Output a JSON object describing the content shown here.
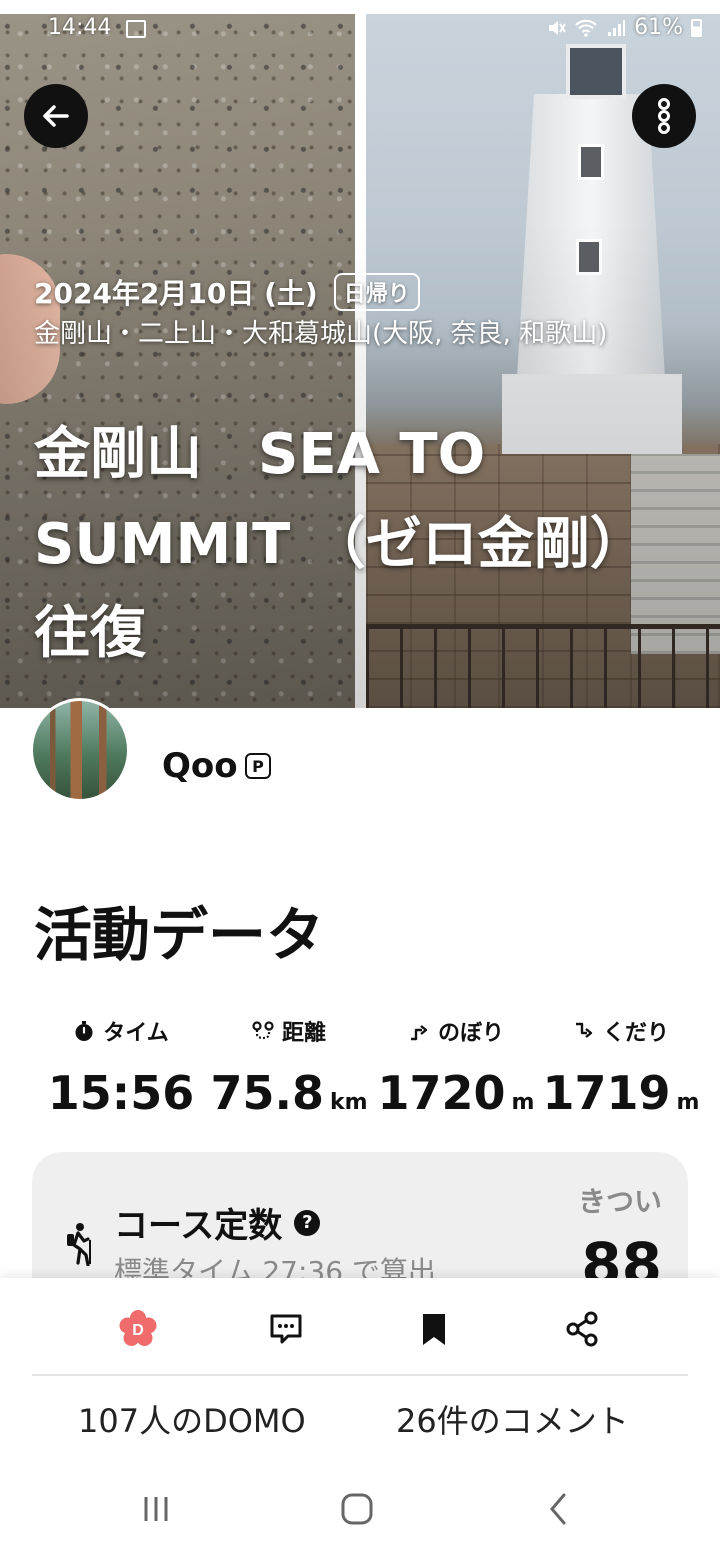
{
  "status_bar": {
    "time": "14:44",
    "battery": "61%",
    "icons": [
      "gallery-icon",
      "mute-icon",
      "wifi-icon",
      "signal-icon",
      "battery-icon"
    ]
  },
  "hero": {
    "date": "2024年2月10日 (土)",
    "day_badge": "日帰り",
    "mountains": "金剛山・二上山・大和葛城山(大阪, 奈良, 和歌山)",
    "title_line1": "金剛山　SEA TO",
    "title_line2": "SUMMIT （ゼロ金剛）",
    "title_line3": "往復"
  },
  "user": {
    "name": "Qoo",
    "premium_badge": "P"
  },
  "activity": {
    "section_title": "活動データ",
    "stats": [
      {
        "label": "タイム",
        "value": "15:56",
        "unit": "",
        "icon": "stopwatch-icon"
      },
      {
        "label": "距離",
        "value": "75.8",
        "unit": "km",
        "icon": "route-icon"
      },
      {
        "label": "のぼり",
        "value": "1720",
        "unit": "m",
        "icon": "ascent-icon"
      },
      {
        "label": "くだり",
        "value": "1719",
        "unit": "m",
        "icon": "descent-icon"
      }
    ]
  },
  "course": {
    "title": "コース定数",
    "help": "?",
    "subtitle": "標準タイム 27:36 で算出",
    "level": "きつい",
    "value": "88"
  },
  "actions": {
    "domo_count": "107人のDOMO",
    "comment_count": "26件のコメント"
  },
  "colors": {
    "domo_accent": "#f06b6b",
    "card_bg": "#efefef",
    "text_primary": "#111111",
    "text_secondary": "#8a8a8a"
  }
}
